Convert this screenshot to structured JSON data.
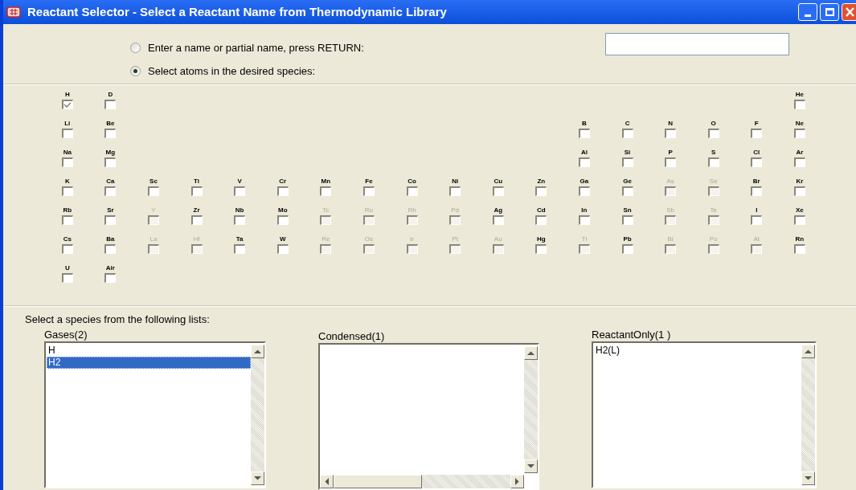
{
  "window": {
    "title": "Reactant Selector - Select a Reactant Name from Thermodynamic Library"
  },
  "mode_options": [
    {
      "label": "Enter a name or partial name, press RETURN:",
      "selected": false
    },
    {
      "label": "Select atoms in the desired species:",
      "selected": true
    }
  ],
  "periodic_table": [
    [
      {
        "kind": "element",
        "symbol": "H",
        "enabled": true,
        "checked": true
      },
      {
        "kind": "element",
        "symbol": "D",
        "enabled": true,
        "checked": false
      },
      {
        "kind": "blank"
      },
      {
        "kind": "blank"
      },
      {
        "kind": "blank"
      },
      {
        "kind": "blank"
      },
      {
        "kind": "blank"
      },
      {
        "kind": "blank"
      },
      {
        "kind": "blank"
      },
      {
        "kind": "blank"
      },
      {
        "kind": "blank"
      },
      {
        "kind": "blank"
      },
      {
        "kind": "blank"
      },
      {
        "kind": "blank"
      },
      {
        "kind": "blank"
      },
      {
        "kind": "blank"
      },
      {
        "kind": "blank"
      },
      {
        "kind": "element",
        "symbol": "He",
        "enabled": true,
        "checked": false
      }
    ],
    [
      {
        "kind": "element",
        "symbol": "Li",
        "enabled": true,
        "checked": false
      },
      {
        "kind": "element",
        "symbol": "Be",
        "enabled": true,
        "checked": false
      },
      {
        "kind": "blank"
      },
      {
        "kind": "blank"
      },
      {
        "kind": "blank"
      },
      {
        "kind": "blank"
      },
      {
        "kind": "blank"
      },
      {
        "kind": "blank"
      },
      {
        "kind": "blank"
      },
      {
        "kind": "blank"
      },
      {
        "kind": "blank"
      },
      {
        "kind": "blank"
      },
      {
        "kind": "element",
        "symbol": "B",
        "enabled": true,
        "checked": false
      },
      {
        "kind": "element",
        "symbol": "C",
        "enabled": true,
        "checked": false
      },
      {
        "kind": "element",
        "symbol": "N",
        "enabled": true,
        "checked": false
      },
      {
        "kind": "element",
        "symbol": "O",
        "enabled": true,
        "checked": false
      },
      {
        "kind": "element",
        "symbol": "F",
        "enabled": true,
        "checked": false
      },
      {
        "kind": "element",
        "symbol": "Ne",
        "enabled": true,
        "checked": false
      }
    ],
    [
      {
        "kind": "element",
        "symbol": "Na",
        "enabled": true,
        "checked": false
      },
      {
        "kind": "element",
        "symbol": "Mg",
        "enabled": true,
        "checked": false
      },
      {
        "kind": "blank"
      },
      {
        "kind": "blank"
      },
      {
        "kind": "blank"
      },
      {
        "kind": "blank"
      },
      {
        "kind": "blank"
      },
      {
        "kind": "blank"
      },
      {
        "kind": "blank"
      },
      {
        "kind": "blank"
      },
      {
        "kind": "blank"
      },
      {
        "kind": "blank"
      },
      {
        "kind": "element",
        "symbol": "Al",
        "enabled": true,
        "checked": false
      },
      {
        "kind": "element",
        "symbol": "Si",
        "enabled": true,
        "checked": false
      },
      {
        "kind": "element",
        "symbol": "P",
        "enabled": true,
        "checked": false
      },
      {
        "kind": "element",
        "symbol": "S",
        "enabled": true,
        "checked": false
      },
      {
        "kind": "element",
        "symbol": "Cl",
        "enabled": true,
        "checked": false
      },
      {
        "kind": "element",
        "symbol": "Ar",
        "enabled": true,
        "checked": false
      }
    ],
    [
      {
        "kind": "element",
        "symbol": "K",
        "enabled": true,
        "checked": false
      },
      {
        "kind": "element",
        "symbol": "Ca",
        "enabled": true,
        "checked": false
      },
      {
        "kind": "element",
        "symbol": "Sc",
        "enabled": true,
        "checked": false
      },
      {
        "kind": "element",
        "symbol": "Ti",
        "enabled": true,
        "checked": false
      },
      {
        "kind": "element",
        "symbol": "V",
        "enabled": true,
        "checked": false
      },
      {
        "kind": "element",
        "symbol": "Cr",
        "enabled": true,
        "checked": false
      },
      {
        "kind": "element",
        "symbol": "Mn",
        "enabled": true,
        "checked": false
      },
      {
        "kind": "element",
        "symbol": "Fe",
        "enabled": true,
        "checked": false
      },
      {
        "kind": "element",
        "symbol": "Co",
        "enabled": true,
        "checked": false
      },
      {
        "kind": "element",
        "symbol": "Ni",
        "enabled": true,
        "checked": false
      },
      {
        "kind": "element",
        "symbol": "Cu",
        "enabled": true,
        "checked": false
      },
      {
        "kind": "element",
        "symbol": "Zn",
        "enabled": true,
        "checked": false
      },
      {
        "kind": "element",
        "symbol": "Ga",
        "enabled": true,
        "checked": false
      },
      {
        "kind": "element",
        "symbol": "Ge",
        "enabled": true,
        "checked": false
      },
      {
        "kind": "element",
        "symbol": "As",
        "enabled": false,
        "checked": false
      },
      {
        "kind": "element",
        "symbol": "Se",
        "enabled": false,
        "checked": false
      },
      {
        "kind": "element",
        "symbol": "Br",
        "enabled": true,
        "checked": false
      },
      {
        "kind": "element",
        "symbol": "Kr",
        "enabled": true,
        "checked": false
      }
    ],
    [
      {
        "kind": "element",
        "symbol": "Rb",
        "enabled": true,
        "checked": false
      },
      {
        "kind": "element",
        "symbol": "Sr",
        "enabled": true,
        "checked": false
      },
      {
        "kind": "element",
        "symbol": "Y",
        "enabled": false,
        "checked": false
      },
      {
        "kind": "element",
        "symbol": "Zr",
        "enabled": true,
        "checked": false
      },
      {
        "kind": "element",
        "symbol": "Nb",
        "enabled": true,
        "checked": false
      },
      {
        "kind": "element",
        "symbol": "Mo",
        "enabled": true,
        "checked": false
      },
      {
        "kind": "element",
        "symbol": "Tc",
        "enabled": false,
        "checked": false
      },
      {
        "kind": "element",
        "symbol": "Ru",
        "enabled": false,
        "checked": false
      },
      {
        "kind": "element",
        "symbol": "Rh",
        "enabled": false,
        "checked": false
      },
      {
        "kind": "element",
        "symbol": "Pd",
        "enabled": false,
        "checked": false
      },
      {
        "kind": "element",
        "symbol": "Ag",
        "enabled": true,
        "checked": false
      },
      {
        "kind": "element",
        "symbol": "Cd",
        "enabled": true,
        "checked": false
      },
      {
        "kind": "element",
        "symbol": "In",
        "enabled": true,
        "checked": false
      },
      {
        "kind": "element",
        "symbol": "Sn",
        "enabled": true,
        "checked": false
      },
      {
        "kind": "element",
        "symbol": "Sb",
        "enabled": false,
        "checked": false
      },
      {
        "kind": "element",
        "symbol": "Te",
        "enabled": false,
        "checked": false
      },
      {
        "kind": "element",
        "symbol": "I",
        "enabled": true,
        "checked": false
      },
      {
        "kind": "element",
        "symbol": "Xe",
        "enabled": true,
        "checked": false
      }
    ],
    [
      {
        "kind": "element",
        "symbol": "Cs",
        "enabled": true,
        "checked": false
      },
      {
        "kind": "element",
        "symbol": "Ba",
        "enabled": true,
        "checked": false
      },
      {
        "kind": "element",
        "symbol": "La",
        "enabled": false,
        "checked": false
      },
      {
        "kind": "element",
        "symbol": "Hf",
        "enabled": false,
        "checked": false
      },
      {
        "kind": "element",
        "symbol": "Ta",
        "enabled": true,
        "checked": false
      },
      {
        "kind": "element",
        "symbol": "W",
        "enabled": true,
        "checked": false
      },
      {
        "kind": "element",
        "symbol": "Re",
        "enabled": false,
        "checked": false
      },
      {
        "kind": "element",
        "symbol": "Os",
        "enabled": false,
        "checked": false
      },
      {
        "kind": "element",
        "symbol": "Ir",
        "enabled": false,
        "checked": false
      },
      {
        "kind": "element",
        "symbol": "Pt",
        "enabled": false,
        "checked": false
      },
      {
        "kind": "element",
        "symbol": "Au",
        "enabled": false,
        "checked": false
      },
      {
        "kind": "element",
        "symbol": "Hg",
        "enabled": true,
        "checked": false
      },
      {
        "kind": "element",
        "symbol": "Tl",
        "enabled": false,
        "checked": false
      },
      {
        "kind": "element",
        "symbol": "Pb",
        "enabled": true,
        "checked": false
      },
      {
        "kind": "element",
        "symbol": "Bi",
        "enabled": false,
        "checked": false
      },
      {
        "kind": "element",
        "symbol": "Po",
        "enabled": false,
        "checked": false
      },
      {
        "kind": "element",
        "symbol": "At",
        "enabled": false,
        "checked": false
      },
      {
        "kind": "element",
        "symbol": "Rn",
        "enabled": true,
        "checked": false
      }
    ],
    [
      {
        "kind": "element",
        "symbol": "U",
        "enabled": true,
        "checked": false
      },
      {
        "kind": "element",
        "symbol": "Air",
        "enabled": true,
        "checked": false
      }
    ]
  ],
  "species_prompt": "Select a species from the following lists:",
  "species_lists": [
    {
      "title": "Gases(2)",
      "horizontal_scrollbar": false,
      "items": [
        {
          "text": "H",
          "selected": false
        },
        {
          "text": "H2",
          "selected": true
        }
      ]
    },
    {
      "title": "Condensed(1)",
      "horizontal_scrollbar": true
    },
    {
      "title": "ReactantOnly(1 )",
      "horizontal_scrollbar": false,
      "items": [
        {
          "text": "H2(L)",
          "selected": false
        }
      ]
    }
  ]
}
